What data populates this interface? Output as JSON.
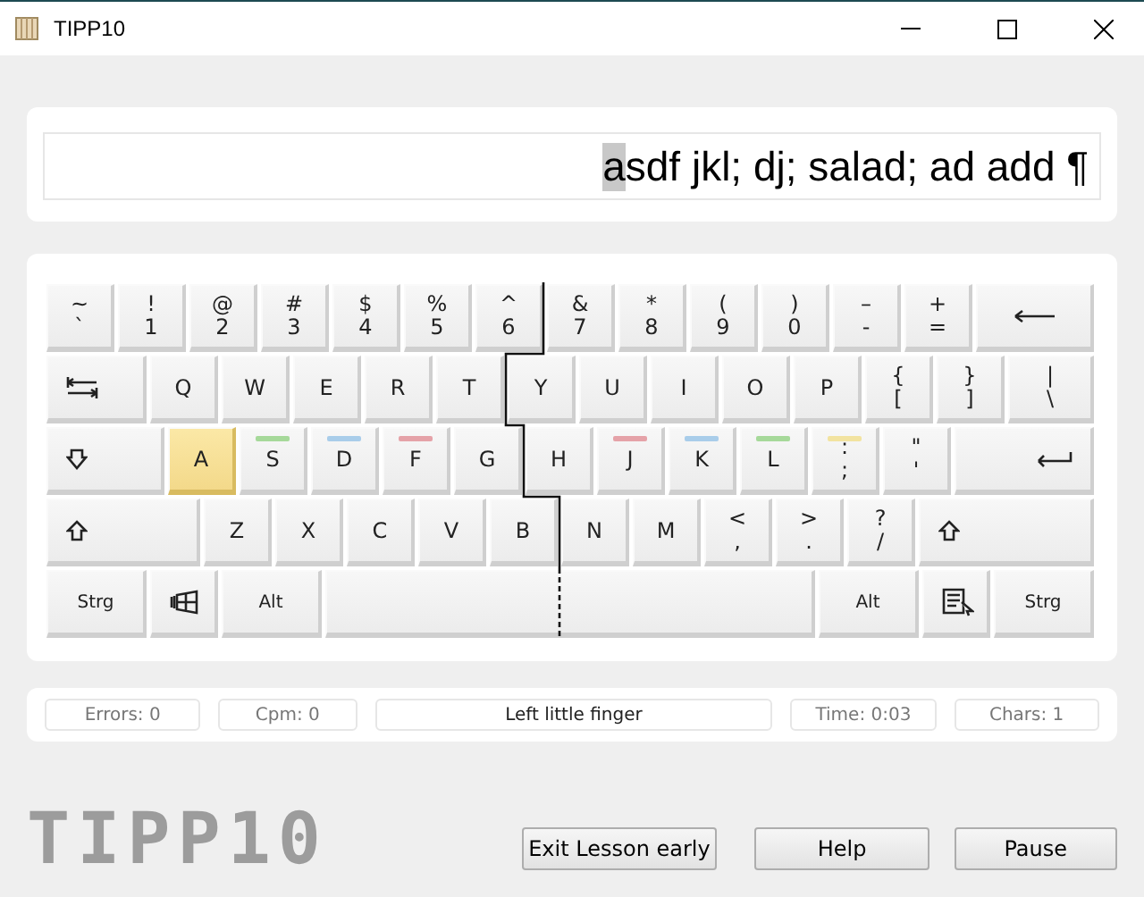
{
  "window": {
    "title": "TIPP10"
  },
  "text_line": {
    "current": "a",
    "upcoming": "sdf jkl; dj; salad; ad add ¶"
  },
  "keyboard": {
    "rows": [
      {
        "keys": [
          {
            "kind": "char",
            "upper": "~",
            "lower": "`",
            "highlighted": false
          },
          {
            "kind": "char",
            "upper": "!",
            "lower": "1",
            "highlighted": false
          },
          {
            "kind": "char",
            "upper": "@",
            "lower": "2",
            "highlighted": false
          },
          {
            "kind": "char",
            "upper": "#",
            "lower": "3",
            "highlighted": false
          },
          {
            "kind": "char",
            "upper": "$",
            "lower": "4",
            "highlighted": false
          },
          {
            "kind": "char",
            "upper": "%",
            "lower": "5",
            "highlighted": false
          },
          {
            "kind": "char",
            "upper": "^",
            "lower": "6",
            "highlighted": false
          },
          {
            "kind": "char",
            "upper": "&",
            "lower": "7",
            "highlighted": false
          },
          {
            "kind": "char",
            "upper": "*",
            "lower": "8",
            "highlighted": false
          },
          {
            "kind": "char",
            "upper": "(",
            "lower": "9",
            "highlighted": false
          },
          {
            "kind": "char",
            "upper": ")",
            "lower": "0",
            "highlighted": false
          },
          {
            "kind": "char",
            "upper": "–",
            "lower": "-",
            "highlighted": false
          },
          {
            "kind": "char",
            "upper": "+",
            "lower": "=",
            "highlighted": false
          },
          {
            "kind": "backspace",
            "highlighted": false
          }
        ]
      },
      {
        "keys": [
          {
            "kind": "tab",
            "highlighted": false
          },
          {
            "kind": "letter",
            "label": "Q",
            "highlighted": false
          },
          {
            "kind": "letter",
            "label": "W",
            "highlighted": false
          },
          {
            "kind": "letter",
            "label": "E",
            "highlighted": false
          },
          {
            "kind": "letter",
            "label": "R",
            "highlighted": false
          },
          {
            "kind": "letter",
            "label": "T",
            "highlighted": false
          },
          {
            "kind": "letter",
            "label": "Y",
            "highlighted": false
          },
          {
            "kind": "letter",
            "label": "U",
            "highlighted": false
          },
          {
            "kind": "letter",
            "label": "I",
            "highlighted": false
          },
          {
            "kind": "letter",
            "label": "O",
            "highlighted": false
          },
          {
            "kind": "letter",
            "label": "P",
            "highlighted": false
          },
          {
            "kind": "char",
            "upper": "{",
            "lower": "[",
            "highlighted": false
          },
          {
            "kind": "char",
            "upper": "}",
            "lower": "]",
            "highlighted": false
          },
          {
            "kind": "char",
            "upper": "|",
            "lower": "\\",
            "highlighted": false
          }
        ]
      },
      {
        "keys": [
          {
            "kind": "capslock",
            "highlighted": false
          },
          {
            "kind": "letter",
            "label": "A",
            "highlighted": true
          },
          {
            "kind": "letter",
            "label": "S",
            "highlighted": false,
            "color": "#a6d99a"
          },
          {
            "kind": "letter",
            "label": "D",
            "highlighted": false,
            "color": "#a9cdea"
          },
          {
            "kind": "letter",
            "label": "F",
            "highlighted": false,
            "color": "#e5a2a8"
          },
          {
            "kind": "letter",
            "label": "G",
            "highlighted": false
          },
          {
            "kind": "letter",
            "label": "H",
            "highlighted": false
          },
          {
            "kind": "letter",
            "label": "J",
            "highlighted": false,
            "color": "#e5a2a8"
          },
          {
            "kind": "letter",
            "label": "K",
            "highlighted": false,
            "color": "#a9cdea"
          },
          {
            "kind": "letter",
            "label": "L",
            "highlighted": false,
            "color": "#a6d99a"
          },
          {
            "kind": "char",
            "upper": ":",
            "lower": ";",
            "highlighted": false,
            "color": "#f2e3a0"
          },
          {
            "kind": "char",
            "upper": "\"",
            "lower": "'",
            "highlighted": false
          },
          {
            "kind": "enter",
            "highlighted": false
          }
        ]
      },
      {
        "keys": [
          {
            "kind": "shift",
            "highlighted": false
          },
          {
            "kind": "letter",
            "label": "Z",
            "highlighted": false
          },
          {
            "kind": "letter",
            "label": "X",
            "highlighted": false
          },
          {
            "kind": "letter",
            "label": "C",
            "highlighted": false
          },
          {
            "kind": "letter",
            "label": "V",
            "highlighted": false
          },
          {
            "kind": "letter",
            "label": "B",
            "highlighted": false
          },
          {
            "kind": "letter",
            "label": "N",
            "highlighted": false
          },
          {
            "kind": "letter",
            "label": "M",
            "highlighted": false
          },
          {
            "kind": "char",
            "upper": "<",
            "lower": ",",
            "highlighted": false
          },
          {
            "kind": "char",
            "upper": ">",
            "lower": ".",
            "highlighted": false
          },
          {
            "kind": "char",
            "upper": "?",
            "lower": "/",
            "highlighted": false
          },
          {
            "kind": "shift_right",
            "highlighted": false
          }
        ]
      },
      {
        "keys": [
          {
            "kind": "word",
            "label": "Strg",
            "highlighted": false
          },
          {
            "kind": "windows",
            "highlighted": false
          },
          {
            "kind": "word",
            "label": "Alt",
            "highlighted": false
          },
          {
            "kind": "space",
            "highlighted": false
          },
          {
            "kind": "word",
            "label": "Alt",
            "highlighted": false
          },
          {
            "kind": "menu",
            "highlighted": false
          },
          {
            "kind": "word",
            "label": "Strg",
            "highlighted": false
          }
        ]
      }
    ]
  },
  "status_bar": [
    {
      "kind": "stat",
      "text": "Errors: 0"
    },
    {
      "kind": "stat",
      "text": "Cpm: 0"
    },
    {
      "kind": "hint",
      "text": "Left little finger"
    },
    {
      "kind": "stat",
      "text": "Time: 0:03"
    },
    {
      "kind": "stat",
      "text": "Chars: 1"
    }
  ],
  "logo": "TIPP10",
  "buttons": [
    "Exit Lesson early",
    "Help",
    "Pause"
  ]
}
